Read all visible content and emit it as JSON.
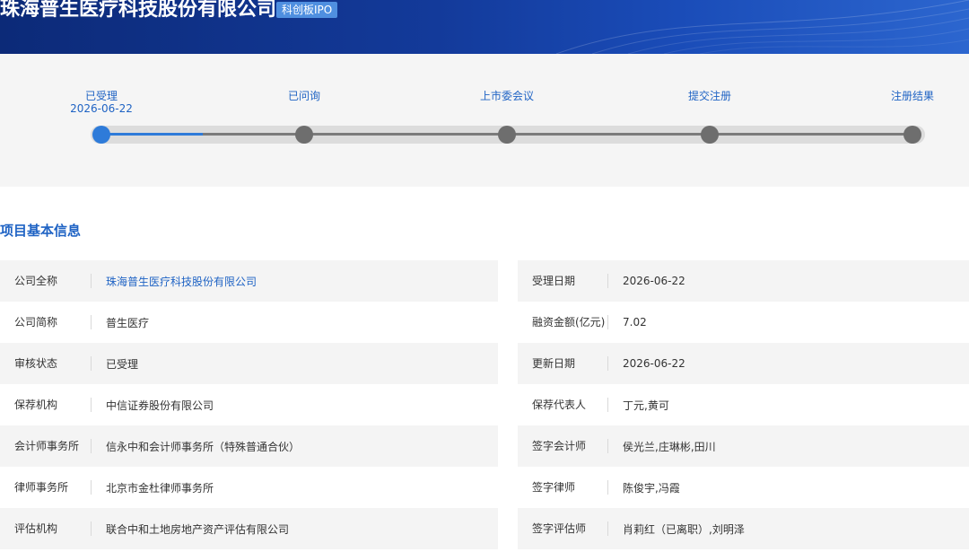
{
  "header": {
    "company_title": "珠海普生医疗科技股份有限公司",
    "board_tag": "科创板IPO",
    "colors": {
      "banner_dark": "#0c2a78",
      "banner_light": "#2c66cf",
      "tag": "#4f8fe0"
    }
  },
  "progress": {
    "current_step": 0,
    "fill_fraction_of_first_segment": 0.5,
    "steps": [
      {
        "label": "已受理",
        "date": "2026-06-22"
      },
      {
        "label": "已问询",
        "date": ""
      },
      {
        "label": "上市委会议",
        "date": ""
      },
      {
        "label": "提交注册",
        "date": ""
      },
      {
        "label": "注册结果",
        "date": ""
      }
    ],
    "colors": {
      "active": "#2e7bd9",
      "inactive": "#6e6e6e",
      "label": "#1f63c4"
    }
  },
  "basic_info": {
    "title": "项目基本信息",
    "left": [
      {
        "label": "公司全称",
        "value": "珠海普生医疗科技股份有限公司"
      },
      {
        "label": "公司简称",
        "value": "普生医疗"
      },
      {
        "label": "审核状态",
        "value": "已受理"
      },
      {
        "label": "保荐机构",
        "value": "中信证券股份有限公司"
      },
      {
        "label": "会计师事务所",
        "value": "信永中和会计师事务所（特殊普通合伙）"
      },
      {
        "label": "律师事务所",
        "value": "北京市金杜律师事务所"
      },
      {
        "label": "评估机构",
        "value": "联合中和土地房地产资产评估有限公司"
      }
    ],
    "right": [
      {
        "label": "受理日期",
        "value": "2026-06-22"
      },
      {
        "label": "融资金额(亿元)",
        "value": "7.02"
      },
      {
        "label": "更新日期",
        "value": "2026-06-22"
      },
      {
        "label": "保荐代表人",
        "value": "丁元,黄可"
      },
      {
        "label": "签字会计师",
        "value": "侯光兰,庄琳彬,田川"
      },
      {
        "label": "签字律师",
        "value": "陈俊宇,冯霞"
      },
      {
        "label": "签字评估师",
        "value": "肖莉红（已离职）,刘明泽"
      }
    ]
  }
}
